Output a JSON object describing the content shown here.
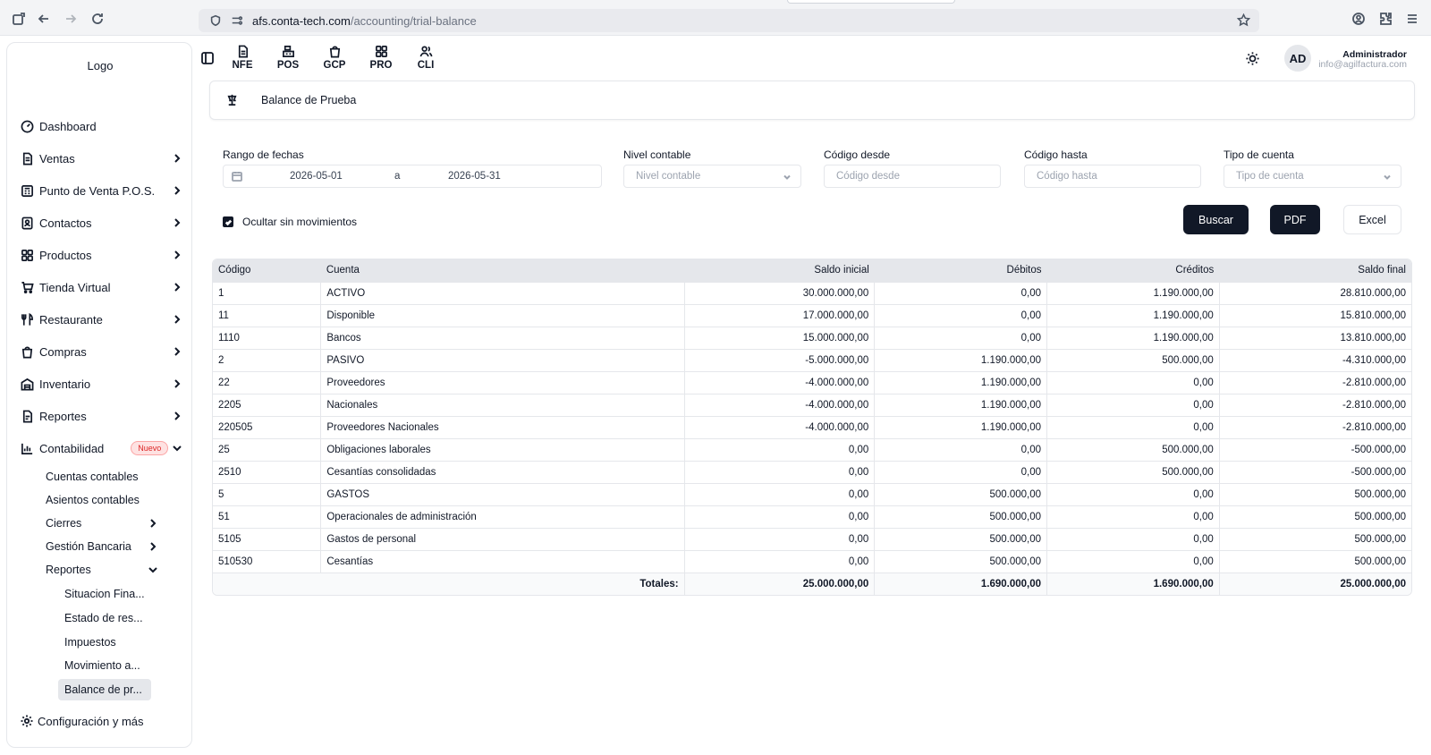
{
  "browser": {
    "url_host": "afs.conta-tech.com",
    "url_path": "/accounting/trial-balance"
  },
  "sidebar": {
    "logo": "Logo",
    "items": [
      {
        "label": "Dashboard",
        "icon": "gauge-icon"
      },
      {
        "label": "Ventas",
        "icon": "document-icon"
      },
      {
        "label": "Punto de Venta P.O.S.",
        "icon": "register-icon"
      },
      {
        "label": "Contactos",
        "icon": "contacts-icon"
      },
      {
        "label": "Productos",
        "icon": "grid-icon"
      },
      {
        "label": "Tienda Virtual",
        "icon": "cart-icon"
      },
      {
        "label": "Restaurante",
        "icon": "utensils-icon"
      },
      {
        "label": "Compras",
        "icon": "bag-icon"
      },
      {
        "label": "Inventario",
        "icon": "warehouse-icon"
      },
      {
        "label": "Reportes",
        "icon": "report-icon"
      },
      {
        "label": "Contabilidad",
        "icon": "chart-icon",
        "badge": "Nuevo"
      }
    ],
    "contabilidad_sub": [
      "Cuentas contables",
      "Asientos contables",
      "Cierres",
      "Gestión Bancaria",
      "Reportes"
    ],
    "reportes_sub": [
      "Situacion Fina...",
      "Estado de res...",
      "Impuestos",
      "Movimiento a...",
      "Balance de pr..."
    ],
    "config": "Configuración y más"
  },
  "topbar": {
    "modules": [
      "NFE",
      "POS",
      "GCP",
      "PRO",
      "CLI"
    ],
    "avatar": "AD",
    "user_name": "Administrador",
    "user_email": "info@agilfactura.com"
  },
  "page": {
    "title": "Balance de Prueba"
  },
  "filters": {
    "date_label": "Rango de fechas",
    "date_from": "2026-05-01",
    "date_sep": "a",
    "date_to": "2026-05-31",
    "nivel_label": "Nivel contable",
    "nivel_placeholder": "Nivel contable",
    "desde_label": "Código desde",
    "desde_placeholder": "Código desde",
    "hasta_label": "Código hasta",
    "hasta_placeholder": "Código hasta",
    "tipo_label": "Tipo de cuenta",
    "tipo_placeholder": "Tipo de cuenta",
    "hide_label": "Ocultar sin movimientos",
    "hide_checked": true,
    "buscar": "Buscar",
    "pdf": "PDF",
    "excel": "Excel"
  },
  "table": {
    "headers": [
      "Código",
      "Cuenta",
      "Saldo inicial",
      "Débitos",
      "Créditos",
      "Saldo final"
    ],
    "rows": [
      [
        "1",
        "ACTIVO",
        "30.000.000,00",
        "0,00",
        "1.190.000,00",
        "28.810.000,00"
      ],
      [
        "11",
        "Disponible",
        "17.000.000,00",
        "0,00",
        "1.190.000,00",
        "15.810.000,00"
      ],
      [
        "1110",
        "Bancos",
        "15.000.000,00",
        "0,00",
        "1.190.000,00",
        "13.810.000,00"
      ],
      [
        "2",
        "PASIVO",
        "-5.000.000,00",
        "1.190.000,00",
        "500.000,00",
        "-4.310.000,00"
      ],
      [
        "22",
        "Proveedores",
        "-4.000.000,00",
        "1.190.000,00",
        "0,00",
        "-2.810.000,00"
      ],
      [
        "2205",
        "Nacionales",
        "-4.000.000,00",
        "1.190.000,00",
        "0,00",
        "-2.810.000,00"
      ],
      [
        "220505",
        "Proveedores Nacionales",
        "-4.000.000,00",
        "1.190.000,00",
        "0,00",
        "-2.810.000,00"
      ],
      [
        "25",
        "Obligaciones laborales",
        "0,00",
        "0,00",
        "500.000,00",
        "-500.000,00"
      ],
      [
        "2510",
        "Cesantías consolidadas",
        "0,00",
        "0,00",
        "500.000,00",
        "-500.000,00"
      ],
      [
        "5",
        "GASTOS",
        "0,00",
        "500.000,00",
        "0,00",
        "500.000,00"
      ],
      [
        "51",
        "Operacionales de administración",
        "0,00",
        "500.000,00",
        "0,00",
        "500.000,00"
      ],
      [
        "5105",
        "Gastos de personal",
        "0,00",
        "500.000,00",
        "0,00",
        "500.000,00"
      ],
      [
        "510530",
        "Cesantías",
        "0,00",
        "500.000,00",
        "0,00",
        "500.000,00"
      ]
    ],
    "totals_label": "Totales:",
    "totals": [
      "25.000.000,00",
      "1.690.000,00",
      "1.690.000,00",
      "25.000.000,00"
    ]
  }
}
